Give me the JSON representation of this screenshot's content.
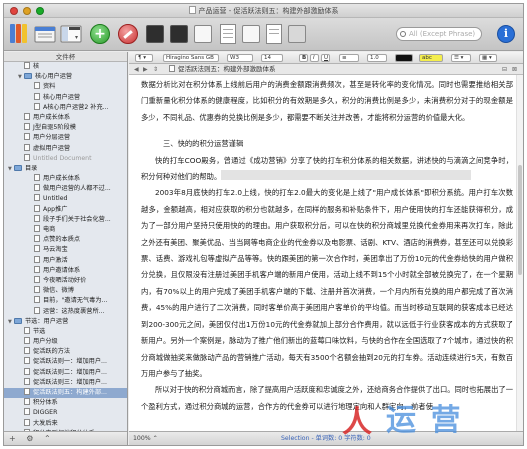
{
  "window": {
    "title": "产品运营 - 促活跃法则五：构建外部激励体系",
    "colors": {
      "close": "#e0443e",
      "minimize": "#dea123",
      "zoom": "#1aab29",
      "selection": "#8ea9cf",
      "status_text": "#3a64b8"
    }
  },
  "toolbar": {
    "search_placeholder": "All (Except Phrase)",
    "icons": [
      "binder-icon",
      "collections-icon",
      "layout-icon",
      "add-icon",
      "delete-icon",
      "quick-reference-icon",
      "compose-icon",
      "snapshot-icon",
      "corkboard-icon",
      "outline-icon",
      "page-icon",
      "keywords-icon",
      "inspector-icon"
    ]
  },
  "binder": {
    "header": "文件杯",
    "items": [
      {
        "label": "核",
        "depth": 1,
        "type": "doc",
        "tri": ""
      },
      {
        "label": "核心用户运营",
        "depth": 1,
        "type": "folder",
        "tri": "▼"
      },
      {
        "label": "资料",
        "depth": 2,
        "type": "doc",
        "tri": ""
      },
      {
        "label": "核心用户运营",
        "depth": 2,
        "type": "doc",
        "tri": ""
      },
      {
        "label": "A核心用户运营2 补充...",
        "depth": 2,
        "type": "doc",
        "tri": ""
      },
      {
        "label": "用户成长体系",
        "depth": 1,
        "type": "doc",
        "tri": ""
      },
      {
        "label": "J型自驱5阶段模",
        "depth": 1,
        "type": "doc",
        "tri": ""
      },
      {
        "label": "用户分层运营",
        "depth": 1,
        "type": "doc",
        "tri": ""
      },
      {
        "label": "虚拟用户运营",
        "depth": 1,
        "type": "doc",
        "tri": ""
      },
      {
        "label": "Untitled Document",
        "depth": 1,
        "type": "doc",
        "tri": "",
        "dim": true
      },
      {
        "label": "目录",
        "depth": 0,
        "type": "folder",
        "tri": "▼"
      },
      {
        "label": "用户成长体系",
        "depth": 2,
        "type": "doc",
        "tri": ""
      },
      {
        "label": "做用户运营的人都不过...",
        "depth": 2,
        "type": "doc",
        "tri": ""
      },
      {
        "label": "Untitled",
        "depth": 2,
        "type": "doc",
        "tri": ""
      },
      {
        "label": "App推广",
        "depth": 2,
        "type": "doc",
        "tri": ""
      },
      {
        "label": "段子手们关于社会化营...",
        "depth": 2,
        "type": "doc",
        "tri": ""
      },
      {
        "label": "电商",
        "depth": 2,
        "type": "doc",
        "tri": ""
      },
      {
        "label": "点赞的本质点",
        "depth": 2,
        "type": "doc",
        "tri": ""
      },
      {
        "label": "马云淘宝",
        "depth": 2,
        "type": "doc",
        "tri": ""
      },
      {
        "label": "用户激活",
        "depth": 2,
        "type": "doc",
        "tri": ""
      },
      {
        "label": "用户邀请体系",
        "depth": 2,
        "type": "doc",
        "tri": ""
      },
      {
        "label": "今夜晒活动好价",
        "depth": 2,
        "type": "doc",
        "tri": ""
      },
      {
        "label": "微信、微博",
        "depth": 2,
        "type": "doc",
        "tri": ""
      },
      {
        "label": "目前，\"邀请无气毒为...",
        "depth": 2,
        "type": "doc",
        "tri": ""
      },
      {
        "label": "运营：这热度裹营所...",
        "depth": 2,
        "type": "doc",
        "tri": ""
      },
      {
        "label": "节选：用户运营",
        "depth": 0,
        "type": "folder",
        "tri": "▼"
      },
      {
        "label": "节选",
        "depth": 1,
        "type": "doc",
        "tri": ""
      },
      {
        "label": "用户分级",
        "depth": 1,
        "type": "doc",
        "tri": ""
      },
      {
        "label": "促活跃的方法",
        "depth": 1,
        "type": "doc",
        "tri": ""
      },
      {
        "label": "促活跃法则一：增加用户...",
        "depth": 1,
        "type": "doc",
        "tri": ""
      },
      {
        "label": "促活跃法则二：增加用户...",
        "depth": 1,
        "type": "doc",
        "tri": ""
      },
      {
        "label": "促活跃法则三：增加用户...",
        "depth": 1,
        "type": "doc",
        "tri": ""
      },
      {
        "label": "促活跃法则五：构建外部...",
        "depth": 1,
        "type": "doc",
        "tri": "",
        "selected": true
      },
      {
        "label": "积分体系",
        "depth": 1,
        "type": "doc",
        "tri": ""
      },
      {
        "label": "DIGGER",
        "depth": 1,
        "type": "doc",
        "tri": ""
      },
      {
        "label": "大发后来",
        "depth": 1,
        "type": "doc",
        "tri": ""
      },
      {
        "label": "积分中到邻地积分体系...",
        "depth": 1,
        "type": "doc",
        "tri": ""
      }
    ],
    "footer": [
      "+",
      "⚙",
      "⌃"
    ]
  },
  "formatbar": {
    "style": "¶ ▾",
    "font": "Hiragino Sans GB",
    "weight": "W3",
    "size": "14",
    "bold": "B",
    "italic": "I",
    "underline": "U",
    "align": "≡",
    "spacing": "1.0",
    "highlight": "abc"
  },
  "editor_header": {
    "title": "促活跃法则五：构建外部激励体系"
  },
  "editor": {
    "paragraphs": [
      {
        "cls": "",
        "text": "数据分析比对在积分体系上线前后用户的消费金额跟消费频次，甚至是转化率的变化情况。同时也需要推给相关部门重新量化积分体系的健康程度，比如积分的有效期是多久，积分的消费比例是多少，未消费积分对于的现金额是多少，不同礼品、优惠券的兑换比例是多少，都需要不断关注并改善，才能将积分运营的价值最大化。"
      },
      {
        "cls": "heading",
        "text": "三、快的的积分运营谨辑"
      },
      {
        "cls": "ind",
        "text": "快的打车COO殿务，曾通过《成功营销》分享了快的打车积分体系的相关数据，讲述快的与滴滴之间竞争时，积分何种对他们的帮助。"
      },
      {
        "cls": "ind",
        "text": "2003年8月底快的打车2.0上线，快的打车2.0最大的变化是上线了\"用户成长体系\"即积分系统。用户打车次数越多，金额越高，相对应获取的积分也就越多，在同样的服务和补贴条件下，用户使用快的打车还能获得积分，成为了一部分用户坚持只使用快的的理由。用户获取积分后，可以在快的积分商城里兑换代金券用来再次打车，除此之外还有美团、聚美优品、当当网等电商企业的代金券以及电影票、话剧、KTV、酒店的消费券，甚至还可以兑换彩票、话费、游戏礼包等虚拟产品等等。快的跟美团的第一次合作时，美团拿出了万份10元的代金券给快的用户做积分兑换，且仅限没有注册过美团手机客户端的新用户使用，活动上线不到15个小时就全部被兑换完了，在一个星期内，有70%以上的用户完成了美团手机客户端的下载、注册并首次消费，一个月内所有兑换的用户都完成了首次消费，45%的用户进行了二次消费，同时客单价高于美团用户客单价的平均值。而当时移动互联网的获客成本已经达到200-300元之间，美团仅付出1万份10元的代金券就加上部分合作费用，就以远低于行业获客成本的方式获取了新用户。另外一个案例是，脉动为了推广他们新出的蓝莓口味饮料，与快的合作在全国选取了7个城市，通过快的积分商城做抽奖来做脉动产品的营销推广活动，每天有3500个名额会抽到20元的打车券。活动连续进行5天，有数百万用户参与了抽奖。"
      },
      {
        "cls": "ind",
        "text": "所以对于快的积分商城而言，除了提高用户活跃度和忠诚度之外，还给商务合作提供了出口。同时也拓展出了一个盈利方式，通过积分商城的运营，合作方的代金券可以进行地理定向和人群定向，前者使"
      }
    ],
    "redacted_line_after": 2
  },
  "status": {
    "zoom": "100% ⌃",
    "stat": "Selection - 单词数: 0   字符数: 0"
  },
  "watermark": {
    "text_left": "人",
    "text_right": "运 营"
  }
}
